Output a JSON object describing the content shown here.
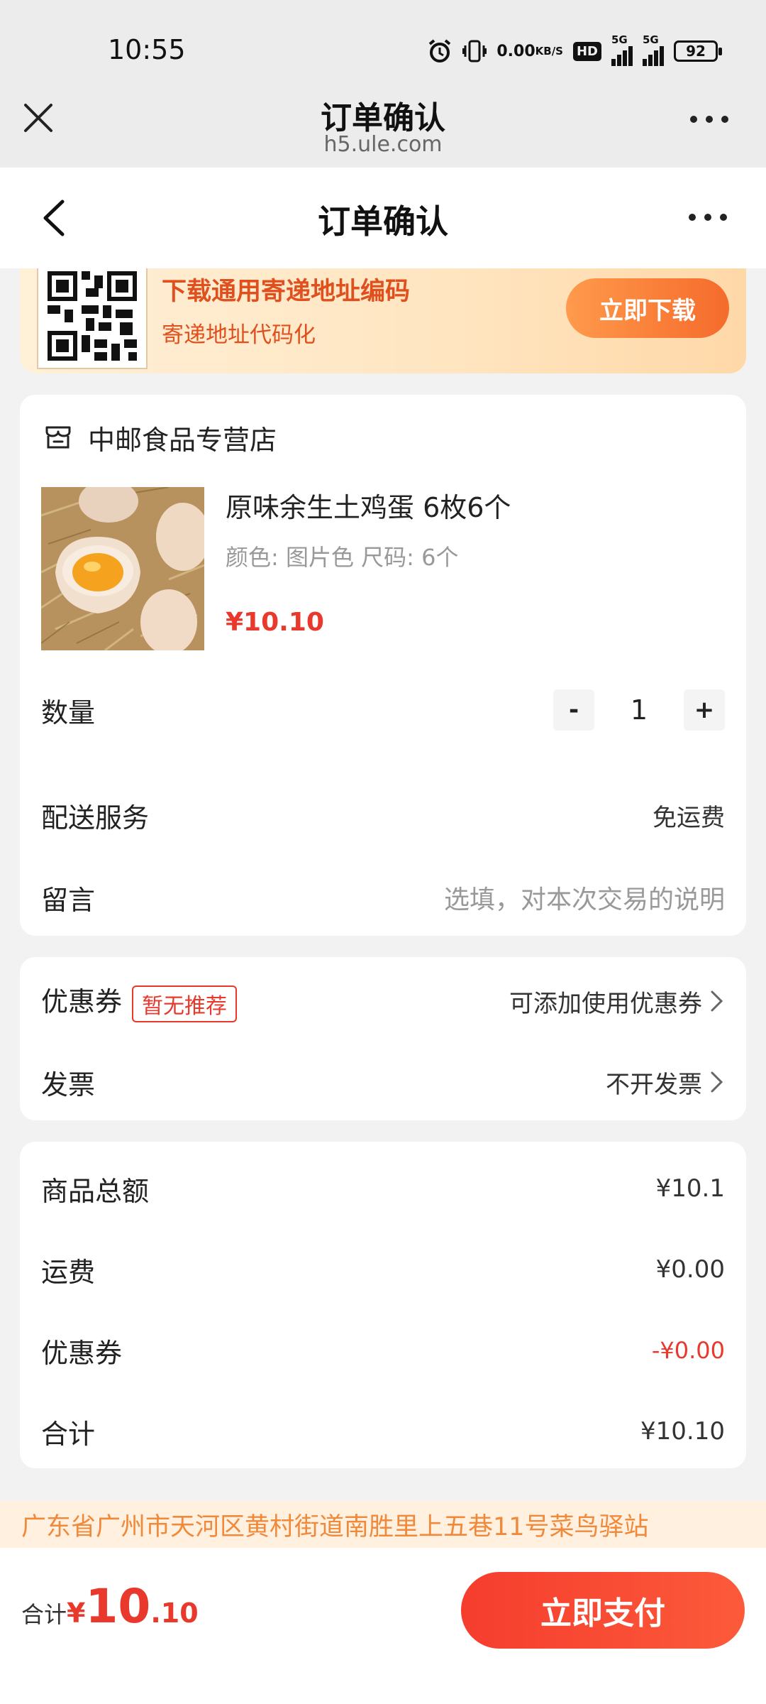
{
  "status_bar": {
    "time": "10:55",
    "net_speed_value": "0.00",
    "net_speed_unit": "KB/S",
    "hd_label": "HD",
    "signal1_label": "5G",
    "signal2_label": "5G",
    "battery": "92",
    "icons": [
      "alarm-icon",
      "vibrate-icon",
      "signal-icon",
      "battery-icon"
    ]
  },
  "browser": {
    "title": "订单确认",
    "url": "h5.ule.com"
  },
  "header": {
    "title": "订单确认"
  },
  "promo": {
    "title": "下载通用寄递地址编码",
    "subtitle": "寄递地址代码化",
    "button": "立即下载",
    "gradient_colors": [
      "#fff0d8",
      "#ffd8a8"
    ],
    "accent": "#e0501e"
  },
  "store": {
    "name": "中邮食品专营店"
  },
  "product": {
    "name": "原味余生土鸡蛋 6枚6个",
    "spec": "颜色: 图片色 尺码: 6个",
    "price": "¥10.10"
  },
  "quantity": {
    "label": "数量",
    "minus": "-",
    "value": "1",
    "plus": "+"
  },
  "delivery": {
    "label": "配送服务",
    "value": "免运费"
  },
  "message": {
    "label": "留言",
    "placeholder": "选填，对本次交易的说明"
  },
  "coupon": {
    "label": "优惠券",
    "badge": "暂无推荐",
    "value": "可添加使用优惠券"
  },
  "invoice": {
    "label": "发票",
    "value": "不开发票"
  },
  "summary": {
    "goods_label": "商品总额",
    "goods_value": "¥10.1",
    "shipping_label": "运费",
    "shipping_value": "¥0.00",
    "coupon_label": "优惠券",
    "coupon_value": "-¥0.00",
    "total_label": "合计",
    "total_value": "¥10.10"
  },
  "address": {
    "text": "广东省广州市天河区黄村街道南胜里上五巷11号菜鸟驿站"
  },
  "bottom": {
    "total_label": "合计",
    "currency": "¥",
    "amount_int": "10",
    "amount_dec": ".10",
    "pay_button": "立即支付",
    "accent": "#e8392c"
  }
}
